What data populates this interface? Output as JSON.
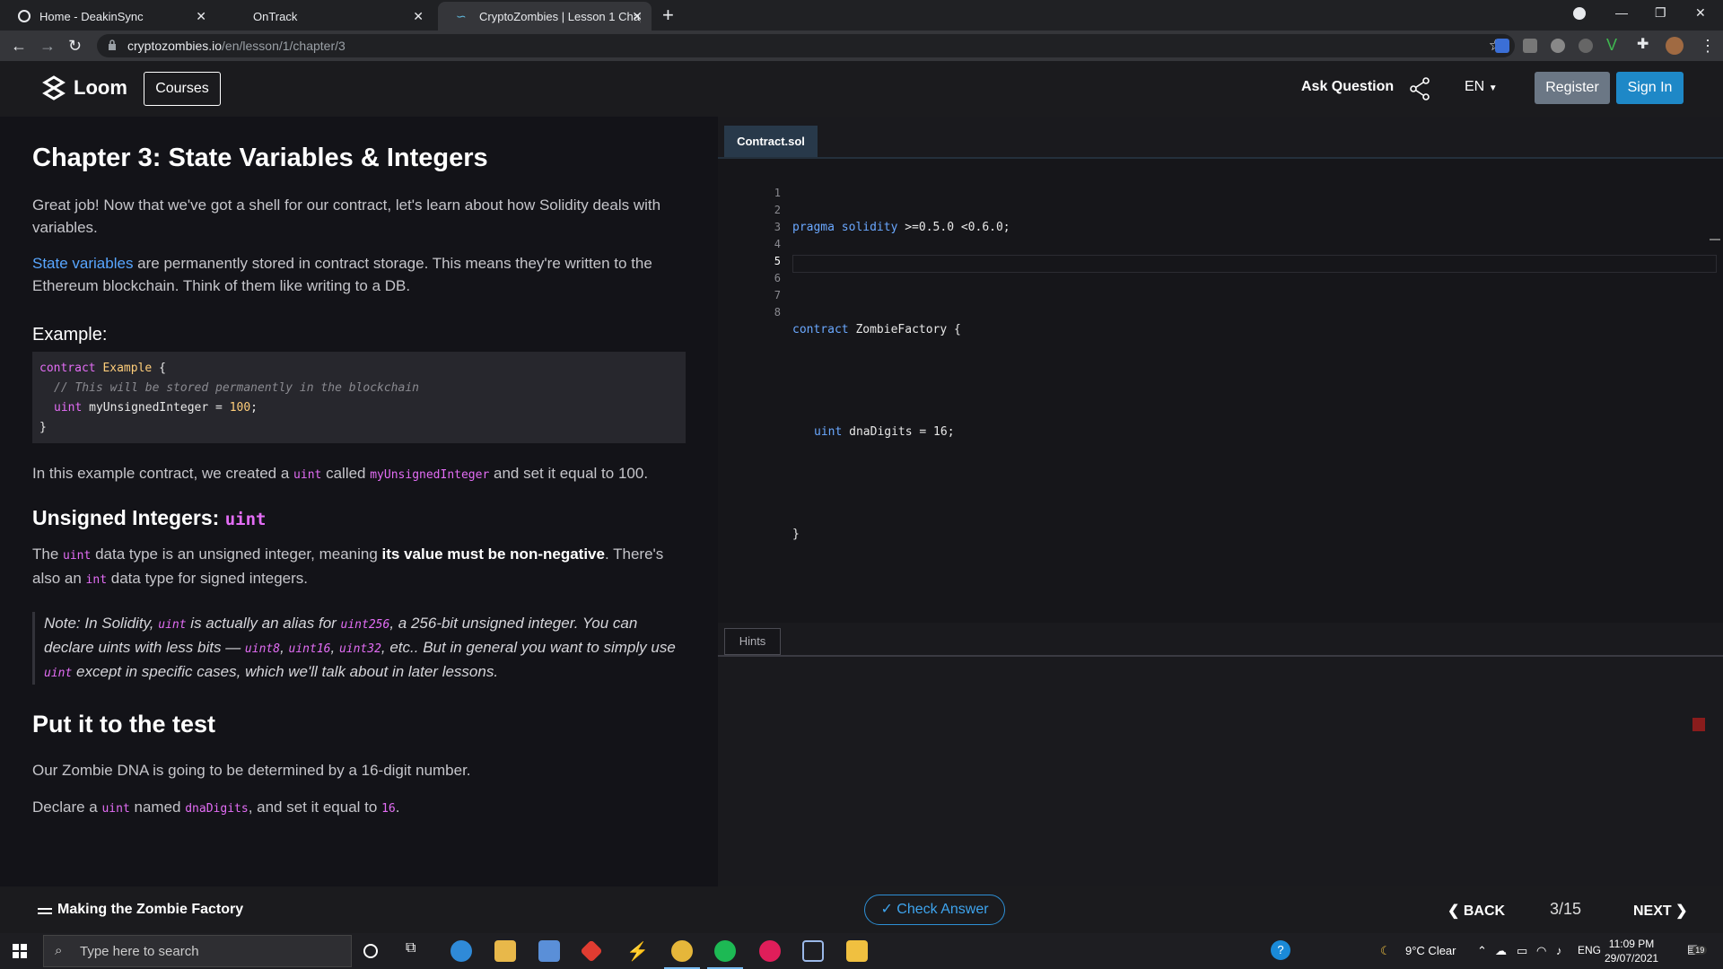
{
  "browser": {
    "tabs": [
      {
        "title": "Home - DeakinSync",
        "active": false
      },
      {
        "title": "OnTrack",
        "active": false
      },
      {
        "title": "CryptoZombies | Lesson 1 Chapt",
        "active": true
      }
    ],
    "url_host": "cryptozombies.io",
    "url_path": "/en/lesson/1/chapter/3"
  },
  "header": {
    "logo_text": "Loom",
    "courses_label": "Courses",
    "ask_label": "Ask Question",
    "lang_label": "EN",
    "register_label": "Register",
    "signin_label": "Sign In"
  },
  "lesson": {
    "title": "Chapter 3: State Variables & Integers",
    "intro": "Great job! Now that we've got a shell for our contract, let's learn about how Solidity deals with variables.",
    "state_link": "State variables",
    "state_text": " are permanently stored in contract storage. This means they're written to the Ethereum blockchain. Think of them like writing to a DB.",
    "example_heading": "Example:",
    "example_code": {
      "line1_kw": "contract",
      "line1_name": "Example",
      "line1_rest": " {",
      "line2": "// This will be stored permanently in the blockchain",
      "line3_kw": "uint",
      "line3_rest": " myUnsignedInteger = ",
      "line3_num": "100",
      "line3_end": ";",
      "line4": "}"
    },
    "example_desc_1": "In this example contract, we created a ",
    "example_desc_code1": "uint",
    "example_desc_2": " called ",
    "example_desc_code2": "myUnsignedInteger",
    "example_desc_3": " and set it equal to 100.",
    "unsigned_heading": "Unsigned Integers: ",
    "unsigned_heading_code": "uint",
    "unsigned_p1": "The ",
    "unsigned_code1": "uint",
    "unsigned_p2": " data type is an unsigned integer, meaning ",
    "unsigned_bold": "its value must be non-negative",
    "unsigned_p3": ". There's also an ",
    "unsigned_code2": "int",
    "unsigned_p4": " data type for signed integers.",
    "note": {
      "t1": "Note: In Solidity, ",
      "c1": "uint",
      "t2": " is actually an alias for ",
      "c2": "uint256",
      "t3": ", a 256-bit unsigned integer. You can declare uints with less bits — ",
      "c3": "uint8",
      "t4": ", ",
      "c4": "uint16",
      "t5": ", ",
      "c5": "uint32",
      "t6": ", etc.. But in general you want to simply use ",
      "c6": "uint",
      "t7": " except in specific cases, which we'll talk about in later lessons."
    },
    "test_heading": "Put it to the test",
    "test_p1": "Our Zombie DNA is going to be determined by a 16-digit number.",
    "test_p2_a": "Declare a ",
    "test_p2_code1": "uint",
    "test_p2_b": " named ",
    "test_p2_code2": "dnaDigits",
    "test_p2_c": ", and set it equal to ",
    "test_p2_code3": "16",
    "test_p2_d": "."
  },
  "editor": {
    "file_tab": "Contract.sol",
    "line_numbers": [
      "1",
      "2",
      "3",
      "4",
      "5",
      "6",
      "7",
      "8"
    ],
    "current_line": "5",
    "line1_kw": "pragma solidity",
    "line1_rest": " >=0.5.0 <0.6.0;",
    "line3_kw": "contract",
    "line3_rest": " ZombieFactory {",
    "line5_kw": "uint",
    "line5_rest": " dnaDigits = 16;",
    "line7": "}",
    "hints_label": "Hints"
  },
  "footer": {
    "title": "Making the Zombie Factory",
    "check_label": "Check Answer",
    "back_label": "BACK",
    "pager": "3/15",
    "next_label": "NEXT"
  },
  "taskbar": {
    "search_placeholder": "Type here to search",
    "weather": "9°C  Clear",
    "lang": "ENG",
    "time": "11:09 PM",
    "date": "29/07/2021",
    "notif_count": "19"
  }
}
